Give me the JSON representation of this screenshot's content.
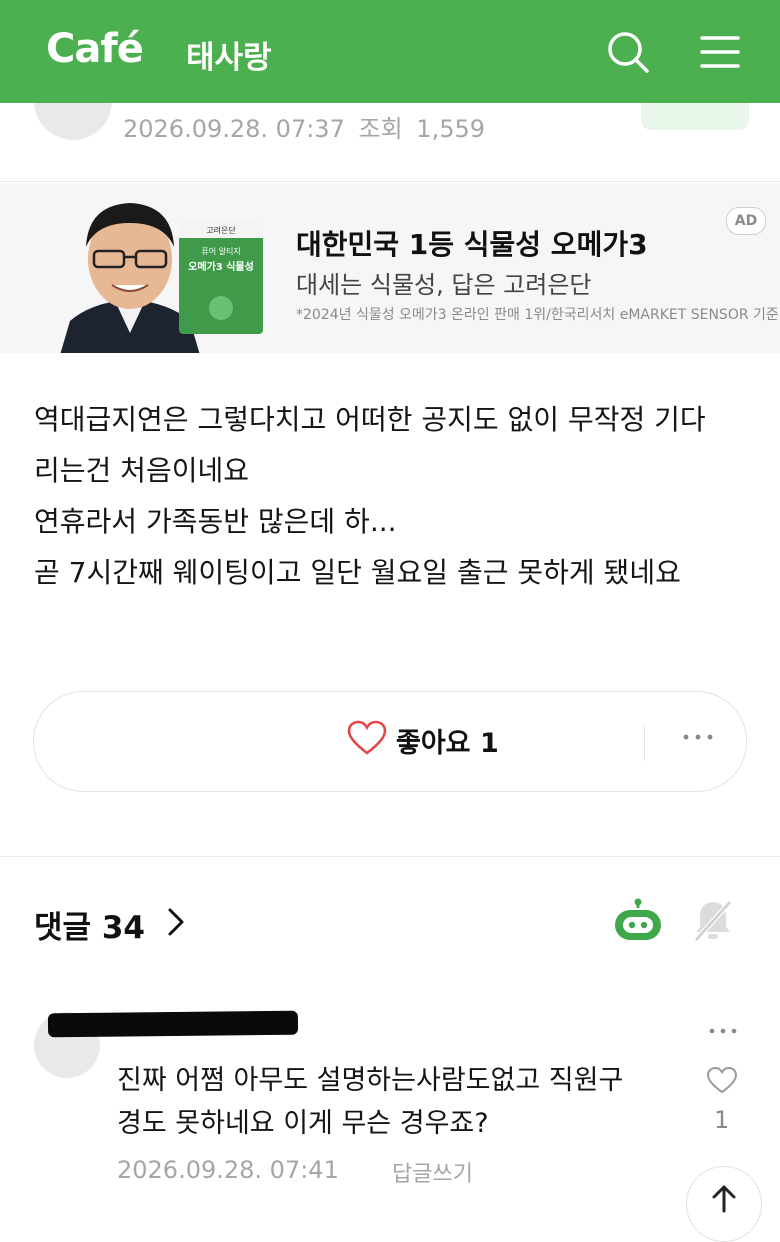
{
  "header": {
    "logo": "Café",
    "cafe_name": "태사랑"
  },
  "post": {
    "date": "2026.09.28. 07:37",
    "views_label": "조회",
    "views": "1,559"
  },
  "ad": {
    "title": "대한민국 1등 식물성 오메가3",
    "subtitle": "대세는 식물성, 답은 고려은단",
    "note": "*2024년 식물성 오메가3 온라인 판매 1위/한국리서치 eMARKET SENSOR 기준",
    "badge": "AD",
    "product_brand": "고려은단",
    "product_name_1": "퓨어 알티지",
    "product_name_2": "오메가3 식물성"
  },
  "body": {
    "lines": [
      "역대급지연은 그렇다치고 어떠한 공지도 없이 무작정 기다",
      "리는건 처음이네요",
      "연휴라서 가족동반 많은데 하...",
      "곧 7시간째 웨이팅이고 일단 월요일 출근 못하게 됐네요"
    ]
  },
  "like": {
    "label": "좋아요",
    "count": "1"
  },
  "comments": {
    "title": "댓글",
    "count": "34",
    "items": [
      {
        "lines": [
          "진짜 어쩜 아무도 설명하는사람도없고 직원구",
          "경도 못하네요 이게 무슨 경우죠?"
        ],
        "date": "2026.09.28. 07:41",
        "reply_label": "답글쓰기",
        "like_count": "1"
      }
    ]
  },
  "colors": {
    "brand_green": "#4caf50",
    "heart_red": "#e04848"
  },
  "icons": [
    "search-icon",
    "menu-icon",
    "heart-icon",
    "more-icon",
    "chevron-right-icon",
    "robot-icon",
    "bell-off-icon",
    "arrow-up-icon"
  ]
}
